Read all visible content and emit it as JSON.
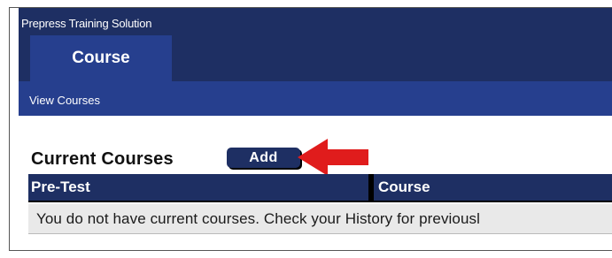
{
  "app": {
    "title": "Prepress Training Solution"
  },
  "tabs": [
    {
      "label": "Course",
      "selected": true
    }
  ],
  "subnav": {
    "view_courses": "View Courses"
  },
  "current_courses": {
    "heading": "Current Courses",
    "add_button": "Add",
    "columns": [
      "Pre-Test",
      "Course"
    ],
    "empty_message": "You do not have current courses. Check your History for previousl"
  },
  "colors": {
    "header_dark": "#1e2f63",
    "header_blue": "#263f8e",
    "callout_arrow": "#e01c1c",
    "row_bg": "#e9e9e9"
  },
  "icons": {
    "callout": "red-arrow-left-icon"
  }
}
